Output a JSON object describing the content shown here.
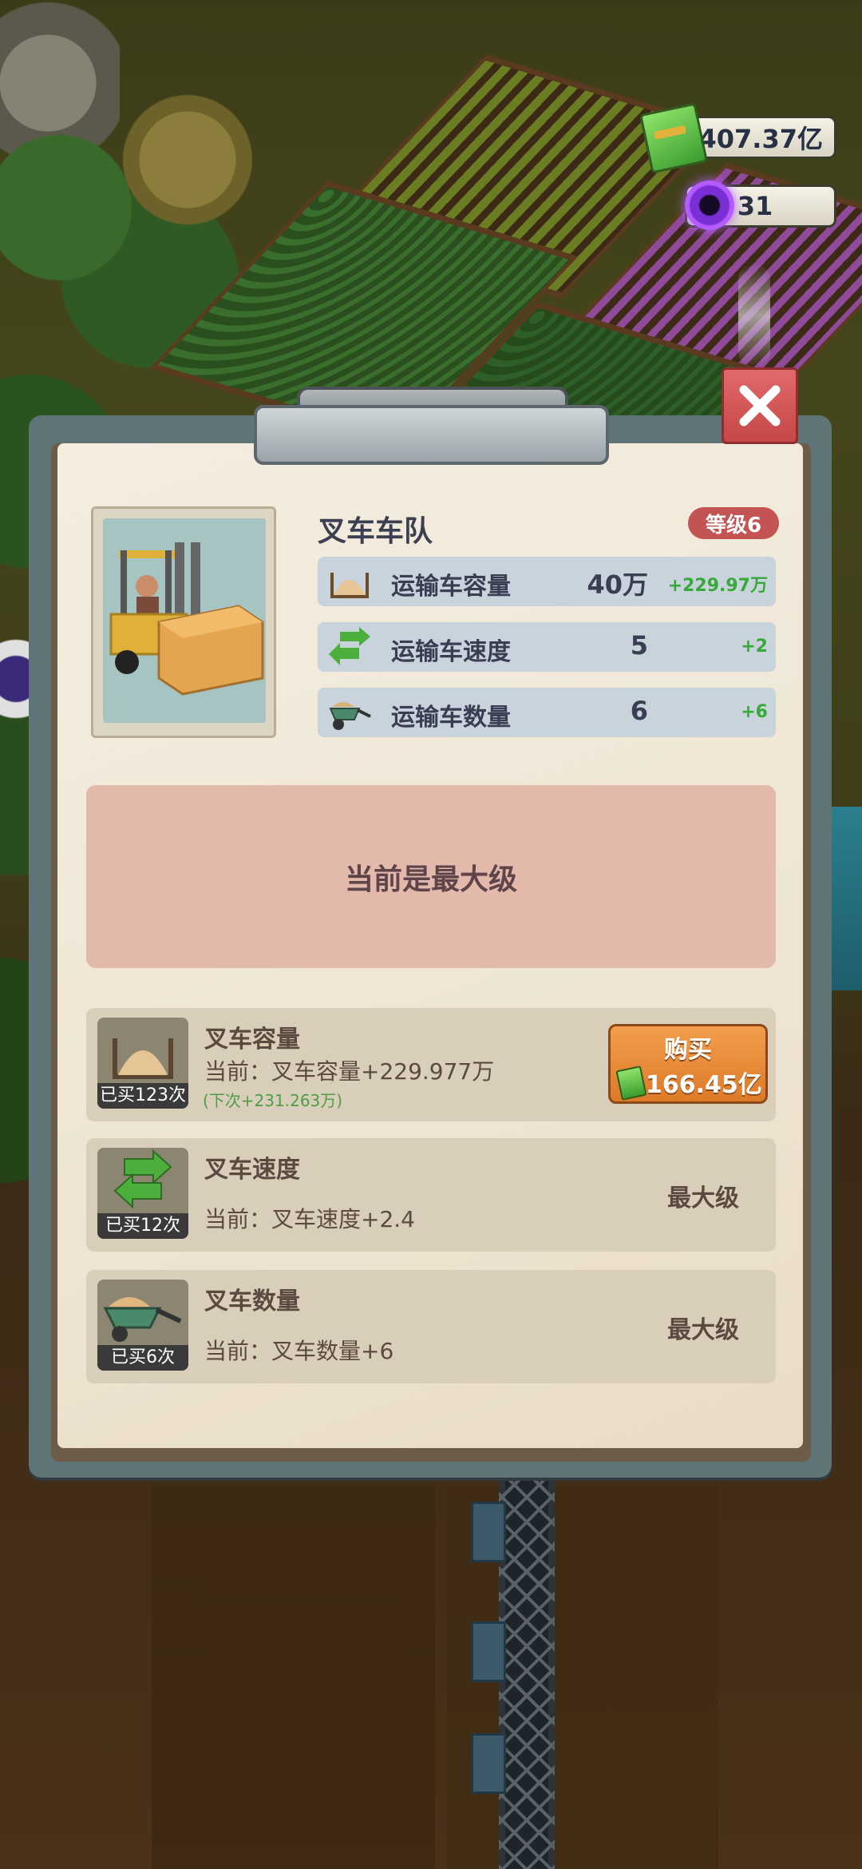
{
  "currency": {
    "cash": "407.37亿",
    "gems": "31"
  },
  "panel": {
    "title": "叉车车队",
    "level": "等级6",
    "stats": [
      {
        "icon": "sand-pile-icon",
        "label": "运输车容量",
        "value": "40万",
        "bonus": "+229.97万"
      },
      {
        "icon": "swap-arrows-icon",
        "label": "运输车速度",
        "value": "5",
        "bonus": "+2"
      },
      {
        "icon": "wheelbarrow-icon",
        "label": "运输车数量",
        "value": "6",
        "bonus": "+6"
      }
    ],
    "max_level_notice": "当前是最大级"
  },
  "upgrades": [
    {
      "icon": "sand-pile-icon",
      "name": "叉车容量",
      "current": "当前：叉车容量+229.977万",
      "next": "(下次+231.263万)",
      "bought": "已买123次",
      "buy_label": "购买",
      "buy_price": "166.45亿"
    },
    {
      "icon": "swap-arrows-icon",
      "name": "叉车速度",
      "current": "当前：叉车速度+2.4",
      "bought": "已买12次",
      "status": "最大级"
    },
    {
      "icon": "wheelbarrow-icon",
      "name": "叉车数量",
      "current": "当前：叉车数量+6",
      "bought": "已买6次",
      "status": "最大级"
    }
  ],
  "colors": {
    "level_badge": "#c45353",
    "buy_button": "#e88a3a",
    "bonus_text": "#37a93a",
    "max_notice_bg": "#e2b9ab"
  }
}
